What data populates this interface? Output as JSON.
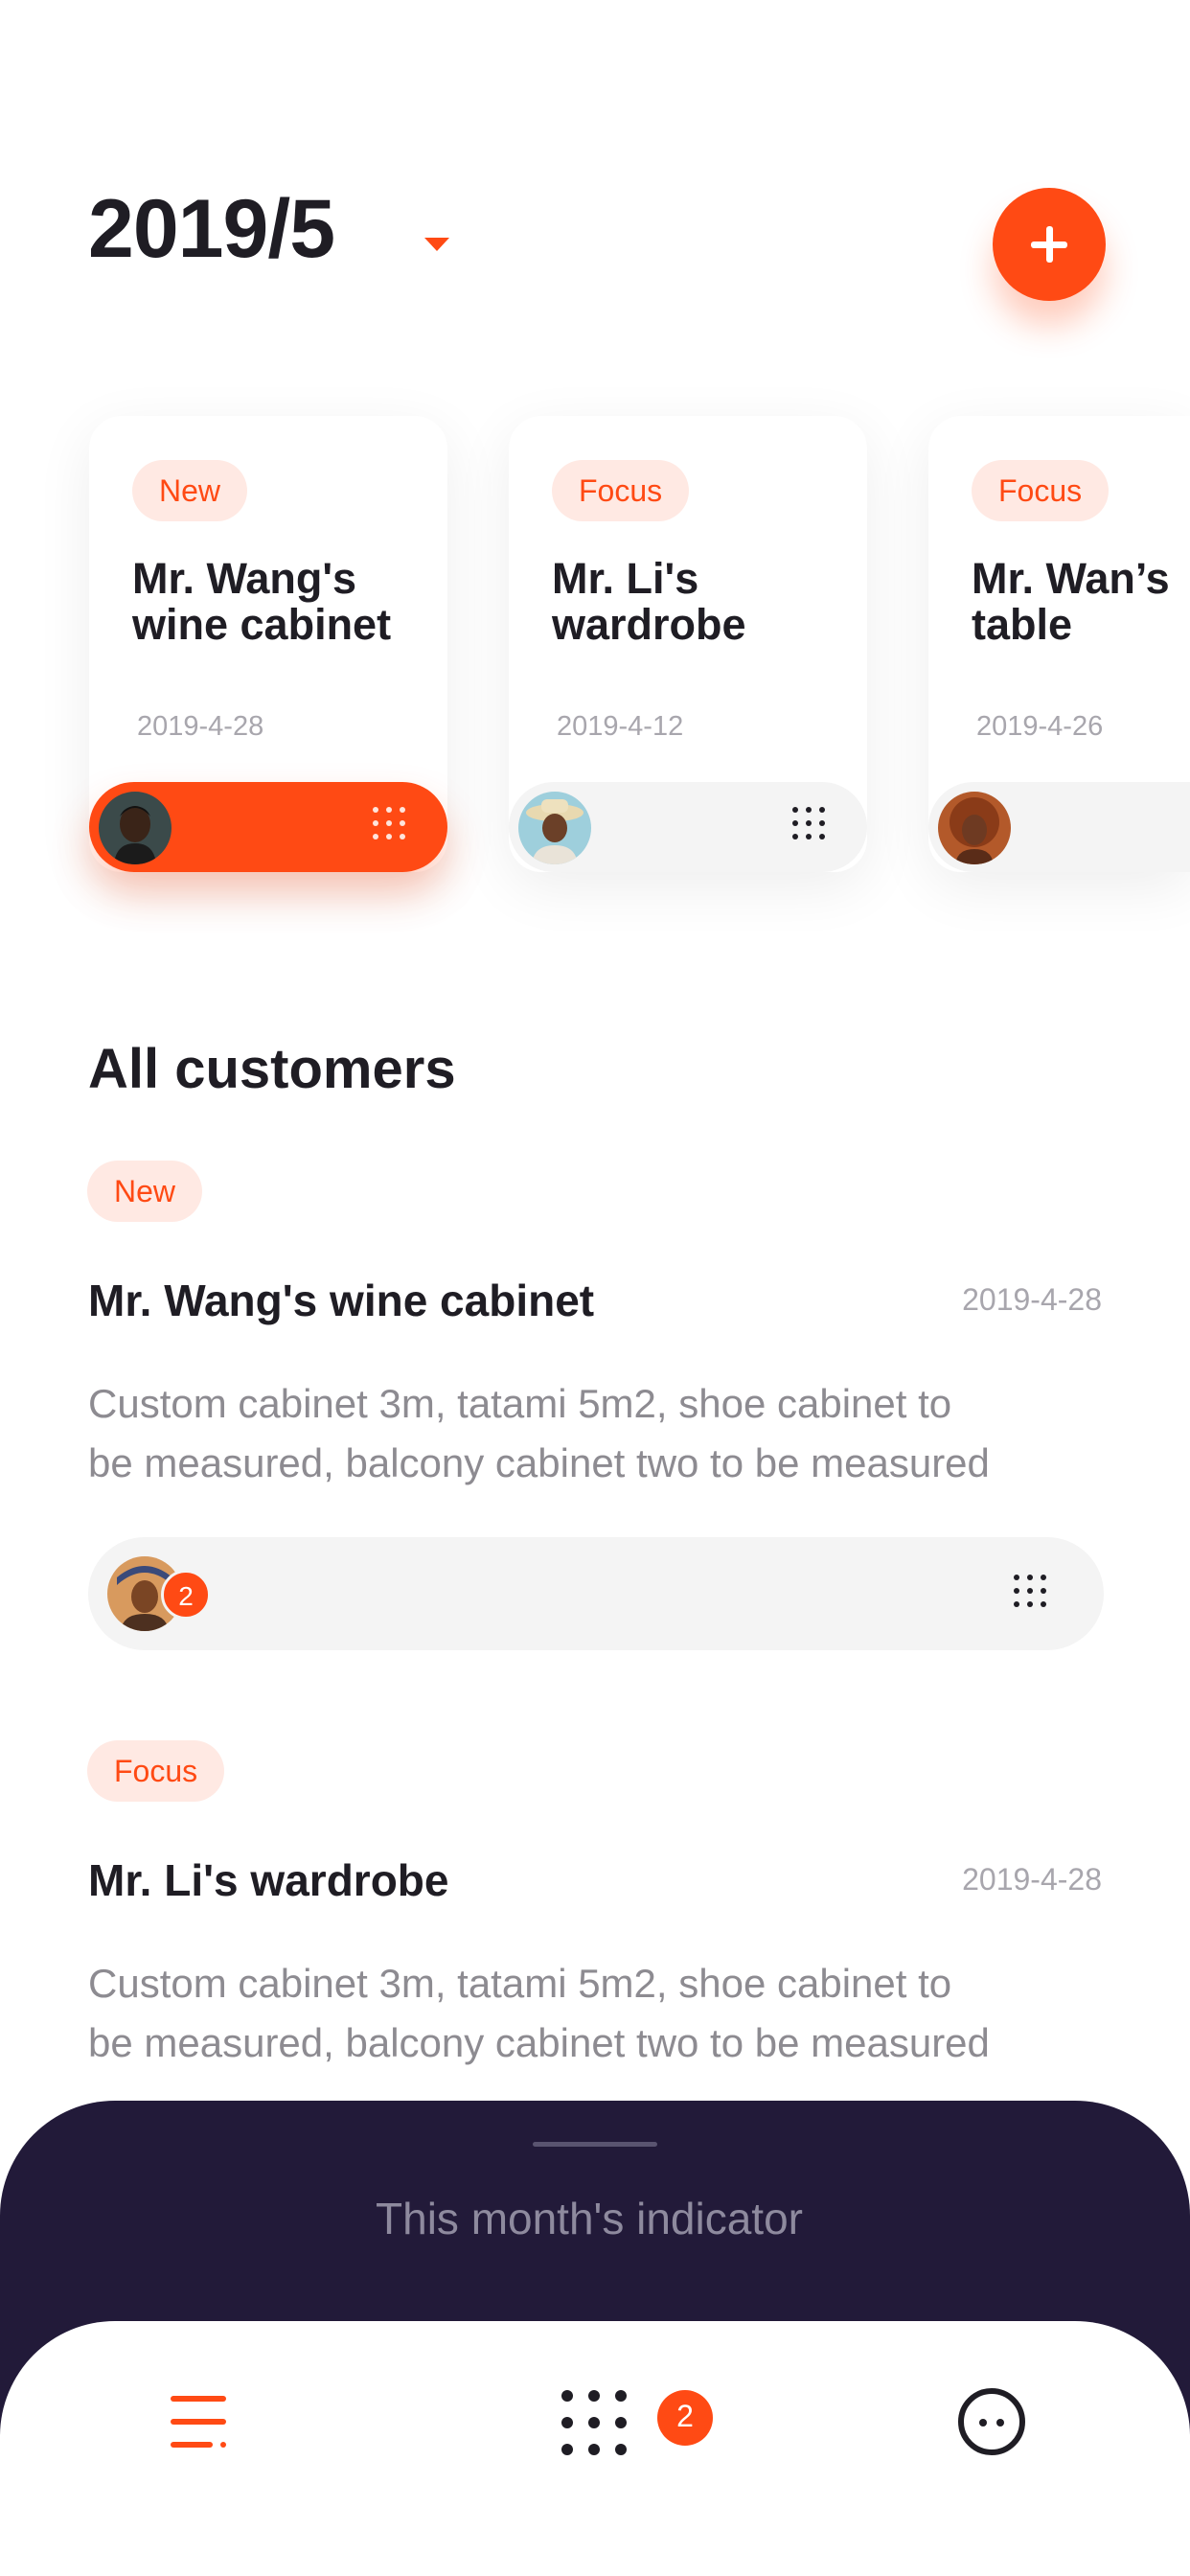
{
  "header": {
    "month_label": "2019/5"
  },
  "cards": [
    {
      "tag": "New",
      "title": "Mr. Wang's wine cabinet",
      "date": "2019-4-28",
      "active": true
    },
    {
      "tag": "Focus",
      "title": "Mr. Li's wardrobe",
      "date": "2019-4-12",
      "active": false
    },
    {
      "tag": "Focus",
      "title": "Mr. Wan’s table",
      "date": "2019-4-26",
      "active": false
    }
  ],
  "section": {
    "title": "All customers"
  },
  "customers": [
    {
      "tag": "New",
      "title": "Mr. Wang's wine cabinet",
      "date": "2019-4-28",
      "desc_line1": "Custom cabinet 3m, tatami 5m2, shoe cabinet to",
      "desc_line2": "be measured, balcony cabinet two to be measured",
      "participants_badge": "2"
    },
    {
      "tag": "Focus",
      "title": "Mr. Li's wardrobe",
      "date": "2019-4-28",
      "desc_line1": "Custom cabinet 3m, tatami 5m2, shoe cabinet to",
      "desc_line2": "be measured, balcony cabinet two to be measured"
    }
  ],
  "sheet": {
    "title": "This month's indicator"
  },
  "nav": {
    "menu_icon": "menu-icon",
    "apps_icon": "apps-grid-icon",
    "apps_badge": "2",
    "more_icon": "more-circle-icon"
  },
  "colors": {
    "accent": "#ff4a14",
    "tag_bg": "#ffe9e3",
    "sheet_bg": "#221a39",
    "text_dark": "#1f1d24",
    "text_muted": "#8d8b91"
  }
}
